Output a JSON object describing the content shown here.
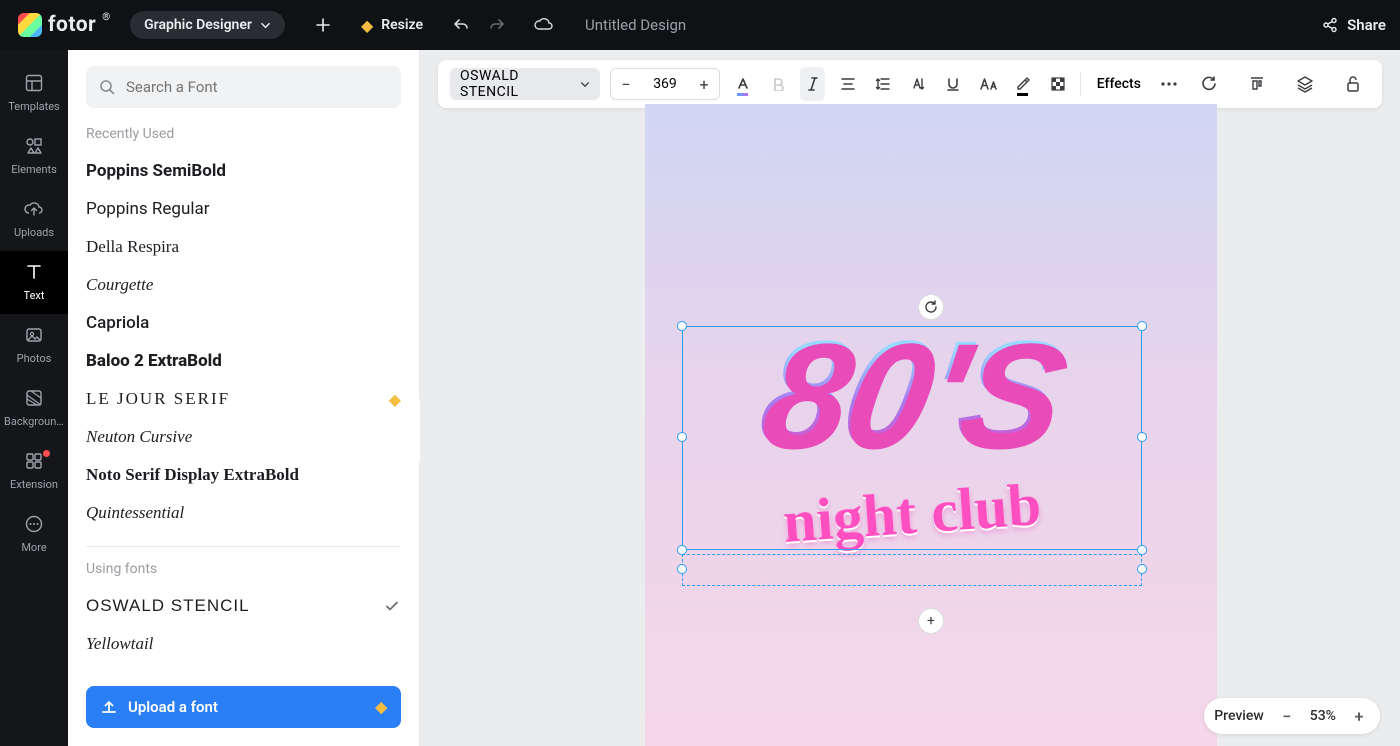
{
  "colors": {
    "accent": "#2a7ef6",
    "selectBlue": "#2a9df4",
    "premium": "#f5bd41",
    "textMuted": "#9a9ca1"
  },
  "header": {
    "brand": "fotor",
    "registered": "®",
    "mode": "Graphic Designer",
    "resize": "Resize",
    "docTitle": "Untitled Design",
    "share": "Share"
  },
  "leftNav": {
    "items": [
      {
        "id": "templates",
        "label": "Templates"
      },
      {
        "id": "elements",
        "label": "Elements"
      },
      {
        "id": "uploads",
        "label": "Uploads"
      },
      {
        "id": "text",
        "label": "Text",
        "active": true
      },
      {
        "id": "photos",
        "label": "Photos"
      },
      {
        "id": "background",
        "label": "Background..."
      },
      {
        "id": "extension",
        "label": "Extension",
        "dot": true
      },
      {
        "id": "more",
        "label": "More"
      }
    ]
  },
  "fontPanel": {
    "searchPlaceholder": "Search a Font",
    "recentlyLabel": "Recently Used",
    "recently": [
      {
        "name": "Poppins SemiBold",
        "cls": "fs-poppins-sb"
      },
      {
        "name": "Poppins Regular",
        "cls": "fs-poppins"
      },
      {
        "name": "Della Respira",
        "cls": "fs-della"
      },
      {
        "name": "Courgette",
        "cls": "fs-courgette"
      },
      {
        "name": "Capriola",
        "cls": "fs-capriola"
      },
      {
        "name": "Baloo 2 ExtraBold",
        "cls": "fs-baloo"
      },
      {
        "name": "LE JOUR SERIF",
        "cls": "fs-lejour",
        "premium": true
      },
      {
        "name": "Neuton Cursive",
        "cls": "fs-neuton"
      },
      {
        "name": "Noto Serif Display ExtraBold",
        "cls": "fs-notoserif"
      },
      {
        "name": "Quintessential",
        "cls": "fs-quint"
      }
    ],
    "usingLabel": "Using fonts",
    "using": [
      {
        "name": "OSWALD STENCIL",
        "cls": "fs-oswald",
        "checked": true
      },
      {
        "name": "Yellowtail",
        "cls": "fs-yellow"
      }
    ],
    "uploadLabel": "Upload a font"
  },
  "contextBar": {
    "fontName": "OSWALD STENCIL",
    "fontSize": "369",
    "effects": "Effects"
  },
  "canvas": {
    "headline": "80'S",
    "subline": "night club"
  },
  "zoom": {
    "preview": "Preview",
    "value": "53%"
  }
}
